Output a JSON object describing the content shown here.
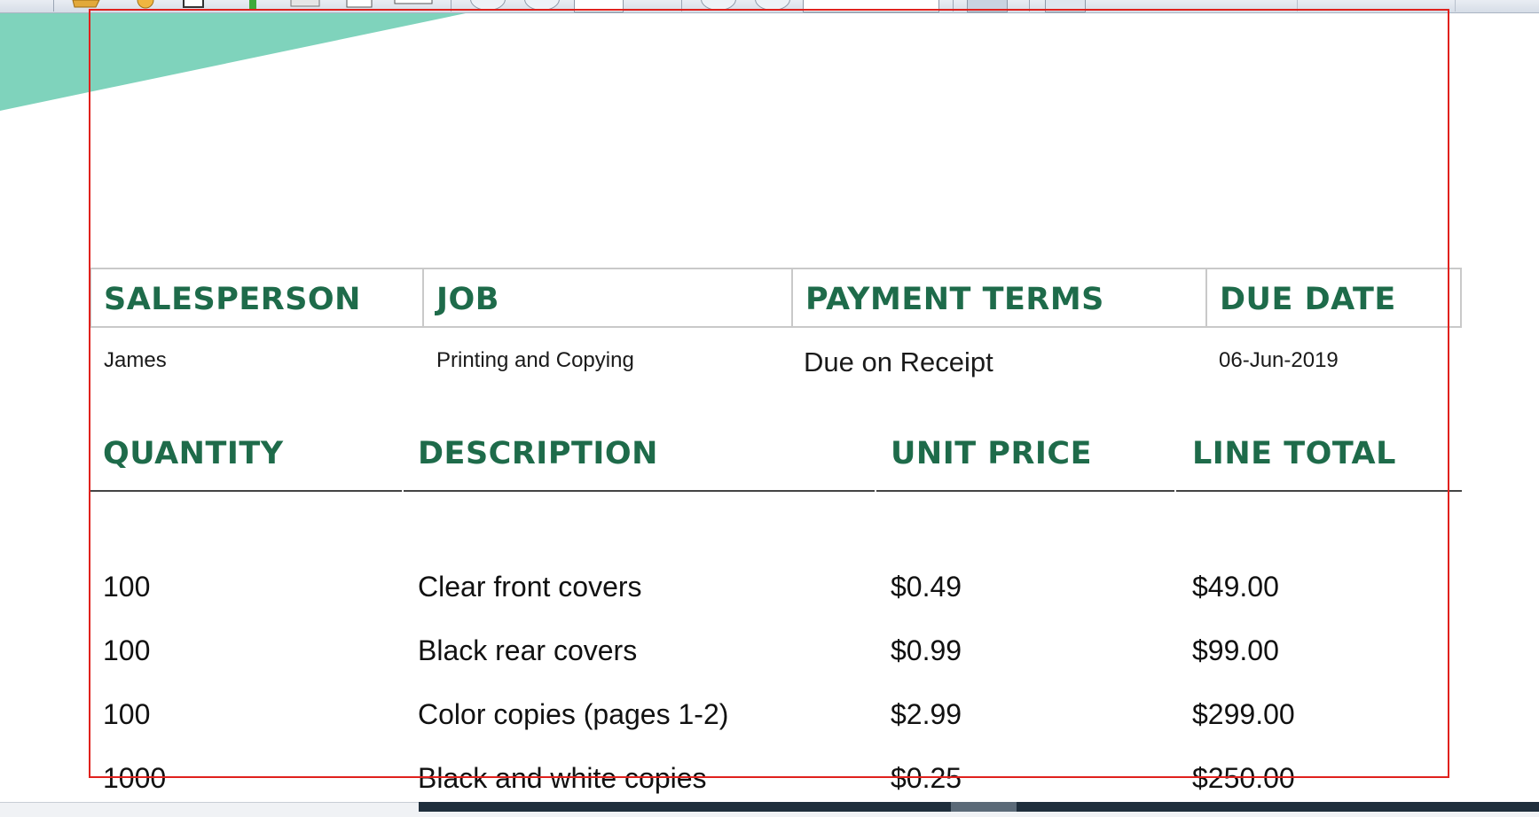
{
  "toolbar": {
    "icons": [
      "open-icon",
      "settings-icon",
      "page-icon",
      "bookmark-icon",
      "save-icon",
      "print-icon",
      "clipboard-icon",
      "back-icon",
      "forward-icon",
      "page-number-field",
      "zoom-out-icon",
      "zoom-in-icon",
      "zoom-field",
      "fit-page-icon",
      "view-icon"
    ]
  },
  "colors": {
    "heading": "#1e6b4a",
    "teal": "#7fd3bc",
    "frame": "#e0211d",
    "text": "#111111"
  },
  "info": {
    "headers": [
      "SALESPERSON",
      "JOB",
      "PAYMENT TERMS",
      "DUE DATE"
    ],
    "values": [
      "James",
      "Printing and Copying",
      "Due on Receipt",
      "06-Jun-2019"
    ]
  },
  "items": {
    "headers": [
      "QUANTITY",
      "DESCRIPTION",
      "UNIT PRICE",
      "LINE TOTAL"
    ],
    "rows": [
      [
        "100",
        "Clear front covers",
        "$0.49",
        "$49.00"
      ],
      [
        "100",
        "Black rear covers",
        "$0.99",
        "$99.00"
      ],
      [
        "100",
        "Color copies (pages 1-2)",
        "$2.99",
        "$299.00"
      ],
      [
        "1000",
        "Black and white copies",
        "$0.25",
        "$250.00"
      ]
    ]
  }
}
